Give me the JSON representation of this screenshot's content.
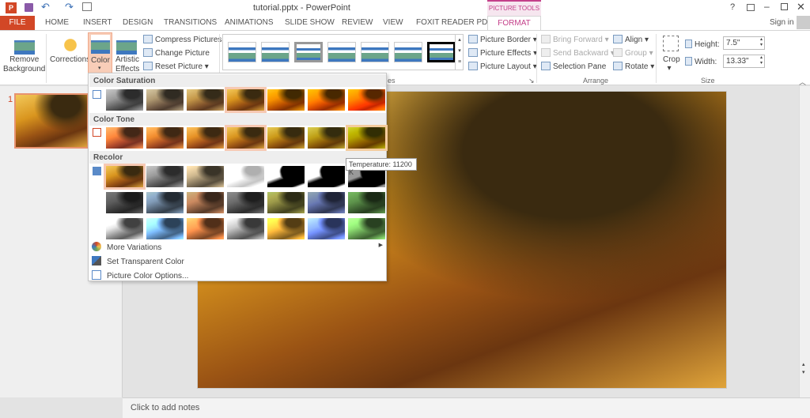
{
  "window": {
    "title": "tutorial.pptx - PowerPoint",
    "help": "?",
    "sign_in": "Sign in"
  },
  "context_tab": {
    "label": "PICTURE TOOLS",
    "color": "#c4408a"
  },
  "tabs": [
    "FILE",
    "HOME",
    "INSERT",
    "DESIGN",
    "TRANSITIONS",
    "ANIMATIONS",
    "SLIDE SHOW",
    "REVIEW",
    "VIEW",
    "FOXIT READER PDF",
    "FORMAT"
  ],
  "active_tab": "FORMAT",
  "ribbon": {
    "remove_bg": [
      "Remove",
      "Background"
    ],
    "corrections": "Corrections",
    "color": "Color",
    "artistic": [
      "Artistic",
      "Effects"
    ],
    "compress": "Compress Pictures",
    "change": "Change Picture",
    "reset": "Reset Picture",
    "picture_border": "Picture Border",
    "picture_effects": "Picture Effects",
    "picture_layout": "Picture Layout",
    "bring_forward": "Bring Forward",
    "send_backward": "Send Backward",
    "selection_pane": "Selection Pane",
    "align": "Align",
    "group": "Group",
    "rotate": "Rotate",
    "arrange_label": "Arrange",
    "styles_label_tail": "es",
    "crop": "Crop",
    "height_label": "Height:",
    "height": "7.5\"",
    "width_label": "Width:",
    "width": "13.33\"",
    "size_label": "Size"
  },
  "color_menu": {
    "saturation": "Color Saturation",
    "tone": "Color Tone",
    "recolor": "Recolor",
    "saturation_selected": 3,
    "tone_selected": 3,
    "tone_hover": 6,
    "recolor_selected": 0,
    "more_variations": "More Variations",
    "set_transparent": "Set Transparent Color",
    "options": "Picture Color Options...",
    "tooltip": "Temperature: 11200 K"
  },
  "slides": [
    {
      "number": "1"
    }
  ],
  "accent": "#d24726",
  "notes_placeholder": "Click to add notes"
}
